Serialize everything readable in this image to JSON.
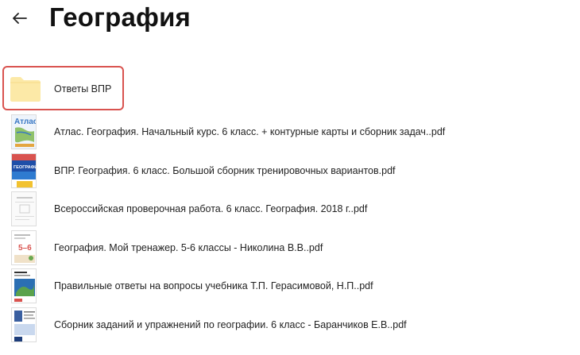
{
  "header": {
    "title": "География",
    "back_icon": "arrow-left-icon"
  },
  "items": [
    {
      "type": "folder",
      "name": "Ответы ВПР",
      "selected": true,
      "icon": "folder-icon"
    },
    {
      "type": "pdf",
      "name": "Атлас. География. Начальный курс. 6 класс. + контурные карты и сборник задач..pdf",
      "thumb_accent": "#3a78c4",
      "thumb_text": "Атлас"
    },
    {
      "type": "pdf",
      "name": "ВПР. География. 6 класс. Большой сборник тренировочных вариантов.pdf",
      "thumb_accent": "#1f4fa8",
      "thumb_text": "ГЕОГРАФИЯ"
    },
    {
      "type": "pdf",
      "name": "Всероссийская проверочная работа. 6 класс. География. 2018 г..pdf",
      "thumb_accent": "#e8e8e8",
      "thumb_text": ""
    },
    {
      "type": "pdf",
      "name": "География. Мой тренажер. 5-6 классы - Николина В.В..pdf",
      "thumb_accent": "#d9534f",
      "thumb_text": "5–6"
    },
    {
      "type": "pdf",
      "name": "Правильные ответы на вопросы учебника Т.П. Герасимовой, Н.П..pdf",
      "thumb_accent": "#2b6fb3",
      "thumb_text": ""
    },
    {
      "type": "pdf",
      "name": "Сборник заданий и упражнений по географии. 6 класс - Баранчиков Е.В..pdf",
      "thumb_accent": "#3a5fa0",
      "thumb_text": ""
    }
  ],
  "colors": {
    "selection_border": "#d9534f",
    "folder": "#fce9a7"
  }
}
